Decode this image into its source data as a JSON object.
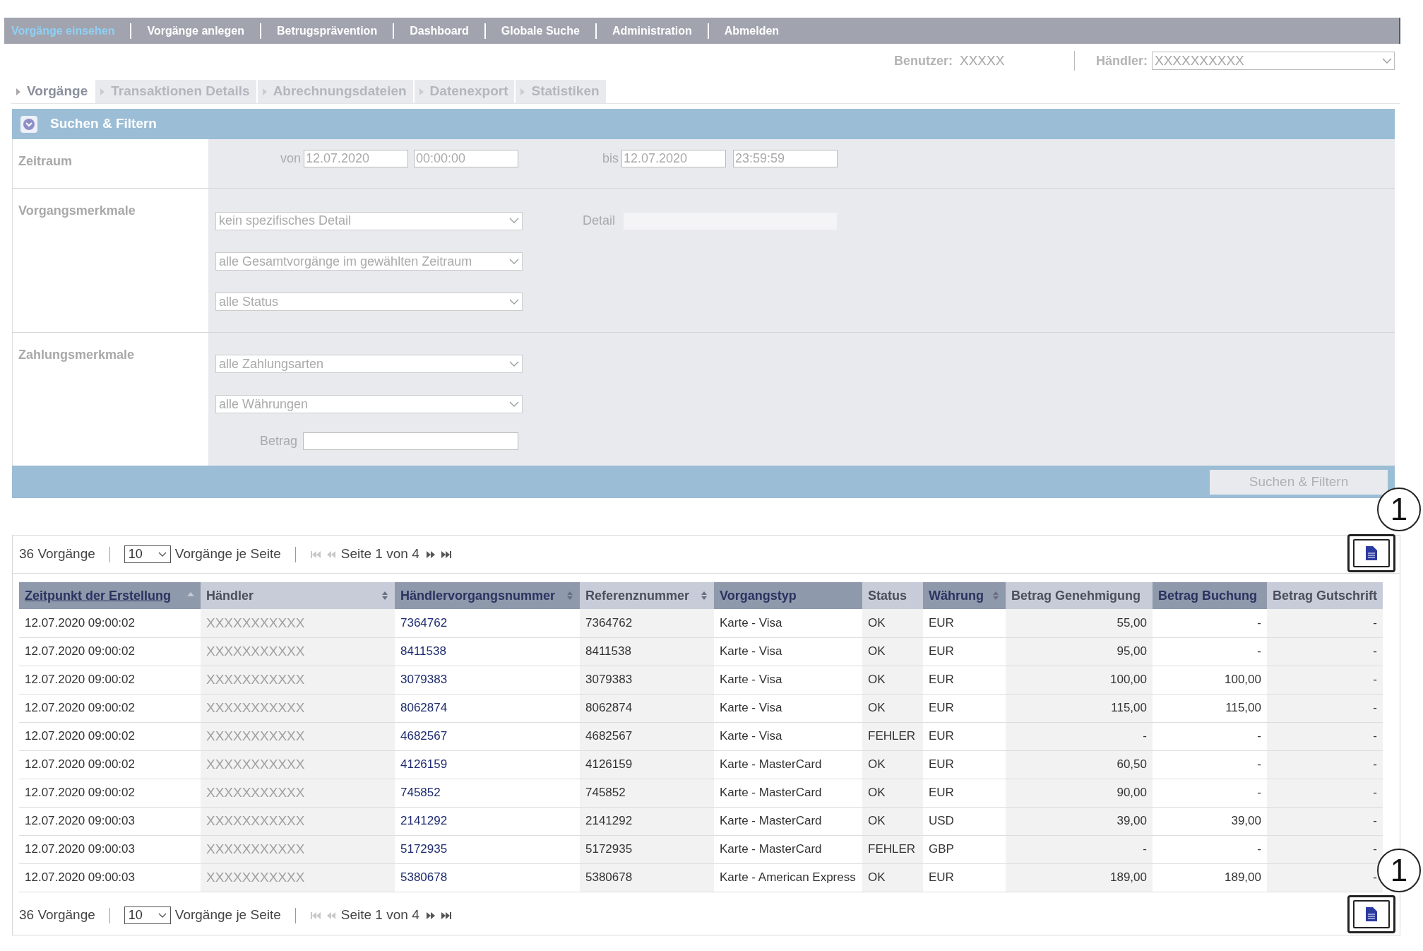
{
  "nav": [
    {
      "label": "Vorgänge einsehen",
      "selected": true
    },
    {
      "label": "Vorgänge anlegen",
      "selected": false
    },
    {
      "label": "Betrugsprävention",
      "selected": false
    },
    {
      "label": "Dashboard",
      "selected": false
    },
    {
      "label": "Globale Suche",
      "selected": false
    },
    {
      "label": "Administration",
      "selected": false
    },
    {
      "label": "Abmelden",
      "selected": false
    }
  ],
  "user": {
    "label": "Benutzer:",
    "value": "XXXXX"
  },
  "merchant": {
    "label": "Händler:",
    "value": "XXXXXXXXXX"
  },
  "subtabs": [
    {
      "label": "Vorgänge",
      "selected": true
    },
    {
      "label": "Transaktionen Details",
      "selected": false
    },
    {
      "label": "Abrechnungsdateien",
      "selected": false
    },
    {
      "label": "Datenexport",
      "selected": false
    },
    {
      "label": "Statistiken",
      "selected": false
    }
  ],
  "filter": {
    "title": "Suchen & Filtern",
    "expanded": true,
    "period": {
      "label": "Zeitraum",
      "from_label": "von",
      "from_date": "12.07.2020",
      "from_time": "00:00:00",
      "to_label": "bis",
      "to_date": "12.07.2020",
      "to_time": "23:59:59"
    },
    "transaction": {
      "label": "Vorgangsmerkmale",
      "selects": [
        "kein spezifisches Detail",
        "alle Gesamtvorgänge im gewählten Zeitraum",
        "alle Status"
      ],
      "detail_label": "Detail"
    },
    "payment": {
      "label": "Zahlungsmerkmale",
      "selects": [
        "alle Zahlungsarten",
        "alle Währungen"
      ],
      "amount_label": "Betrag"
    },
    "submit": "Suchen & Filtern"
  },
  "pager_top": {
    "count": "36 Vorgänge",
    "page_size": "10",
    "page_size_label": "Vorgänge je Seite",
    "page_text": "Seite 1 von 4",
    "callout": "1"
  },
  "table": {
    "columns": [
      {
        "label": "Zeitpunkt der Erstellung",
        "sortable": true,
        "sorted": true
      },
      {
        "label": "Händler",
        "sortable": true,
        "sorted": false
      },
      {
        "label": "Händlervorgangsnummer",
        "sortable": true,
        "sorted": false
      },
      {
        "label": "Referenznummer",
        "sortable": true,
        "sorted": false
      },
      {
        "label": "Vorgangstyp",
        "sortable": false,
        "sorted": false
      },
      {
        "label": "Status",
        "sortable": false,
        "sorted": false
      },
      {
        "label": "Währung",
        "sortable": true,
        "sorted": false
      },
      {
        "label": "Betrag Genehmigung",
        "sortable": false,
        "sorted": false
      },
      {
        "label": "Betrag Buchung",
        "sortable": false,
        "sorted": false
      },
      {
        "label": "Betrag Gutschrift",
        "sortable": false,
        "sorted": false
      }
    ],
    "rows": [
      [
        "12.07.2020 09:00:02",
        "XXXXXXXXXXX",
        "7364762",
        "7364762",
        "Karte - Visa",
        "OK",
        "EUR",
        "55,00",
        "-",
        "-"
      ],
      [
        "12.07.2020 09:00:02",
        "XXXXXXXXXXX",
        "8411538",
        "8411538",
        "Karte - Visa",
        "OK",
        "EUR",
        "95,00",
        "-",
        "-"
      ],
      [
        "12.07.2020 09:00:02",
        "XXXXXXXXXXX",
        "3079383",
        "3079383",
        "Karte - Visa",
        "OK",
        "EUR",
        "100,00",
        "100,00",
        "-"
      ],
      [
        "12.07.2020 09:00:02",
        "XXXXXXXXXXX",
        "8062874",
        "8062874",
        "Karte - Visa",
        "OK",
        "EUR",
        "115,00",
        "115,00",
        "-"
      ],
      [
        "12.07.2020 09:00:02",
        "XXXXXXXXXXX",
        "4682567",
        "4682567",
        "Karte - Visa",
        "FEHLER",
        "EUR",
        "-",
        "-",
        "-"
      ],
      [
        "12.07.2020 09:00:02",
        "XXXXXXXXXXX",
        "4126159",
        "4126159",
        "Karte - MasterCard",
        "OK",
        "EUR",
        "60,50",
        "-",
        "-"
      ],
      [
        "12.07.2020 09:00:02",
        "XXXXXXXXXXX",
        "745852",
        "745852",
        "Karte - MasterCard",
        "OK",
        "EUR",
        "90,00",
        "-",
        "-"
      ],
      [
        "12.07.2020 09:00:03",
        "XXXXXXXXXXX",
        "2141292",
        "2141292",
        "Karte - MasterCard",
        "OK",
        "USD",
        "39,00",
        "39,00",
        "-"
      ],
      [
        "12.07.2020 09:00:03",
        "XXXXXXXXXXX",
        "5172935",
        "5172935",
        "Karte - MasterCard",
        "FEHLER",
        "GBP",
        "-",
        "-",
        "-"
      ],
      [
        "12.07.2020 09:00:03",
        "XXXXXXXXXXX",
        "5380678",
        "5380678",
        "Karte - American Express",
        "OK",
        "EUR",
        "189,00",
        "189,00",
        "-"
      ]
    ]
  },
  "pager_bottom": {
    "count": "36 Vorgänge",
    "page_size": "10",
    "page_size_label": "Vorgänge je Seite",
    "page_text": "Seite 1 von 4",
    "callout": "1"
  }
}
